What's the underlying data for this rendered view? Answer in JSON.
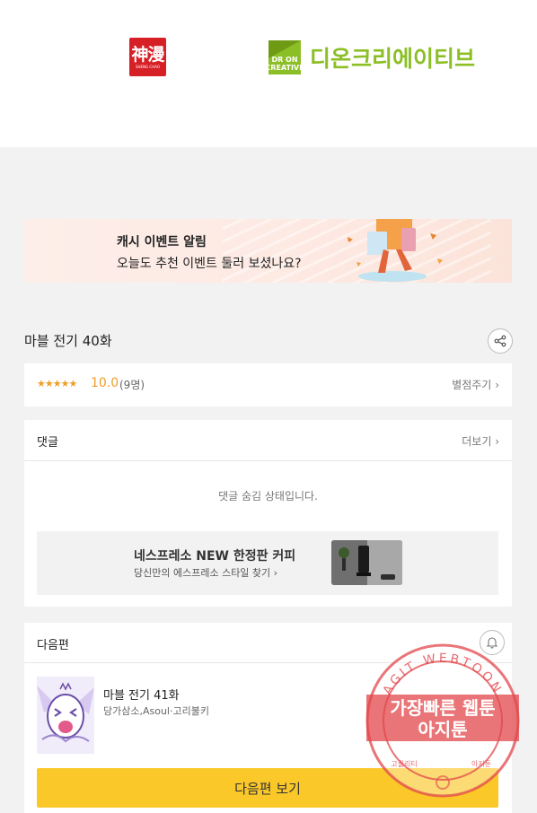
{
  "header": {
    "logo_left_big": "神漫",
    "logo_left_small": "SHENG CHAO",
    "logo_right_mark": "DR ON\nCREATIVE",
    "logo_right_name": "디온크리에이티브"
  },
  "banner": {
    "title": "캐시 이벤트 알림",
    "subtitle": "오늘도 추천 이벤트 둘러 보셨나요?"
  },
  "episode": {
    "title": "마블 전기 40화",
    "share_icon": "share-icon"
  },
  "rating": {
    "stars": "★★★★★",
    "score": "10.0",
    "count": "(9명)",
    "rate_link": "별점주기"
  },
  "comments": {
    "heading": "댓글",
    "more": "더보기",
    "hidden_message": "댓글 숨김 상태입니다."
  },
  "ad": {
    "title": "네스프레소 NEW 한정판 커피",
    "subtitle": "당신만의 에스프레소 스타일 찾기"
  },
  "next": {
    "heading": "다음편",
    "bell_icon": "bell-icon",
    "episode_name": "마블 전기 41화",
    "authors": "당가삼소,Asoul·고리불키",
    "button": "다음편 보기"
  },
  "watermark": {
    "ring_text": "AGIT WEBTOON",
    "line1": "가장빠른 웹툰",
    "line2": "아지툰",
    "bottom_left": "고퀄리티",
    "bottom_right": "아지툰"
  },
  "colors": {
    "accent_yellow": "#fbc82a",
    "star_orange": "#f09d27",
    "brand_green": "#8cbf26",
    "brand_red": "#d71f26",
    "watermark_red": "#e2474b"
  }
}
